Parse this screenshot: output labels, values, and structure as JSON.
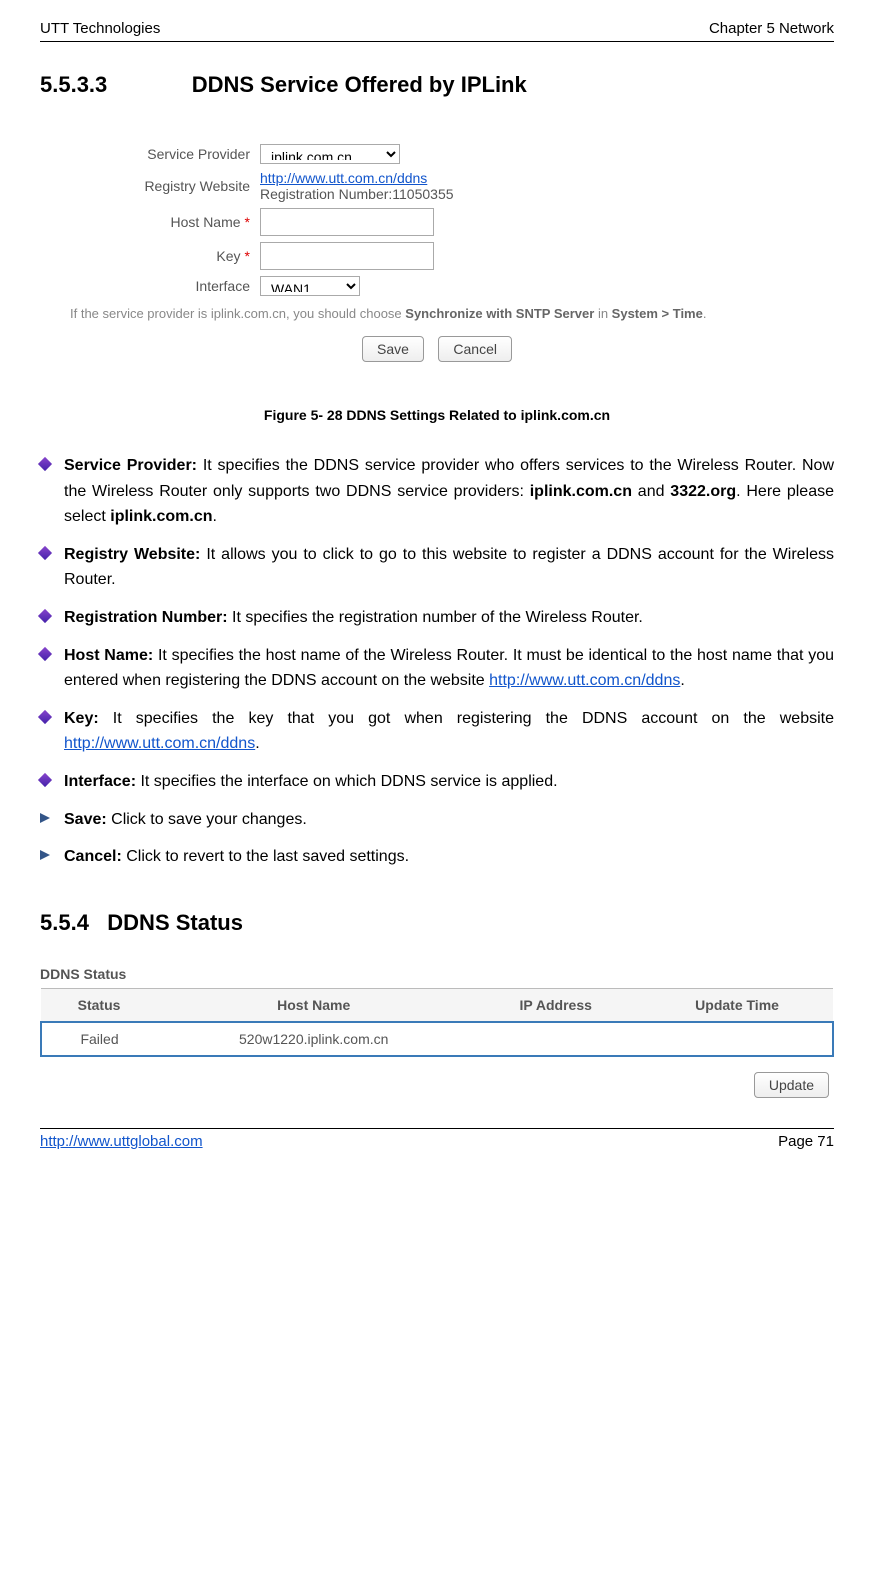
{
  "header": {
    "left": "UTT Technologies",
    "right": "Chapter 5 Network"
  },
  "section": {
    "number": "5.5.3.3",
    "title": "DDNS Service Offered by IPLink"
  },
  "form": {
    "serviceProvider": {
      "label": "Service Provider",
      "value": "iplink.com.cn"
    },
    "registryWebsite": {
      "label": "Registry Website",
      "link": "http://www.utt.com.cn/ddns",
      "regNum": "Registration Number:11050355"
    },
    "hostName": {
      "label": "Host Name"
    },
    "key": {
      "label": "Key"
    },
    "interface": {
      "label": "Interface",
      "value": "WAN1"
    },
    "note_prefix": "If the service provider is iplink.com.cn, you should choose ",
    "note_bold": "Synchronize with SNTP Server",
    "note_mid": " in ",
    "note_bold2": "System > Time",
    "note_end": ".",
    "save": "Save",
    "cancel": "Cancel"
  },
  "figureCaption": "Figure 5- 28 DDNS Settings Related to iplink.com.cn",
  "bullets": {
    "sp_label": "Service Provider: ",
    "sp_text1": "It specifies the DDNS service provider who offers services to the Wireless Router. Now the Wireless Router only supports two DDNS service providers: ",
    "sp_b1": "iplink.com.cn",
    "sp_mid": " and ",
    "sp_b2": "3322.org",
    "sp_text2": ". Here please select ",
    "sp_b3": "iplink.com.cn",
    "sp_end": ".",
    "rw_label": "Registry Website: ",
    "rw_text": "It allows you to click   to go to this website to register a DDNS account for the Wireless Router.",
    "rn_label": "Registration Number: ",
    "rn_text": "It specifies the registration number of the Wireless Router.",
    "hn_label": "Host Name: ",
    "hn_text": "It specifies the host name of the Wireless Router. It must be identical to the host name that you entered when registering the DDNS account on the website ",
    "hn_link": "http://www.utt.com.cn/ddns",
    "hn_end": ".",
    "key_label": "Key: ",
    "key_text": "It specifies the key that you got when registering the DDNS account on the website ",
    "key_link": "http://www.utt.com.cn/ddns",
    "key_end": ".",
    "if_label": "Interface: ",
    "if_text": "It specifies the interface on which DDNS service is applied.",
    "save_label": "Save: ",
    "save_text": "Click to save your changes.",
    "cancel_label": "Cancel: ",
    "cancel_text": "Click to revert to the last saved settings."
  },
  "subsection": {
    "number": "5.5.4",
    "title": "DDNS Status"
  },
  "statusTable": {
    "heading": "DDNS Status",
    "headers": [
      "Status",
      "Host Name",
      "IP Address",
      "Update Time"
    ],
    "row": [
      "Failed",
      "520w1220.iplink.com.cn",
      "",
      ""
    ],
    "updateBtn": "Update"
  },
  "footer": {
    "left": "http://www.uttglobal.com",
    "right": "Page 71"
  }
}
